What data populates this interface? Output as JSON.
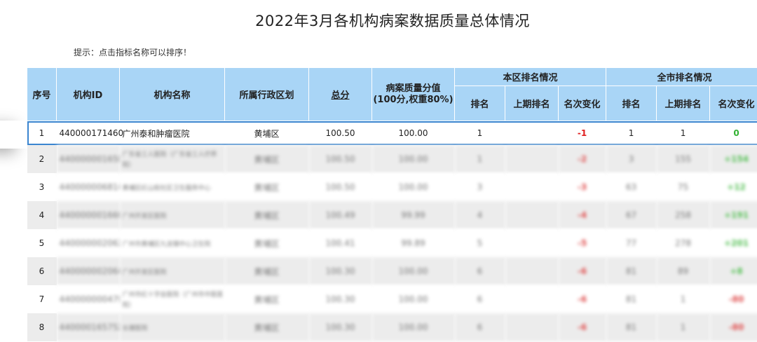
{
  "page": {
    "title": "2022年3月各机构病案数据质量总体情况",
    "hint": "提示：点击指标名称可以排序！"
  },
  "table": {
    "group_headers": {
      "district": "本区排名情况",
      "city": "全市排名情况"
    },
    "headers": {
      "index": "序号",
      "org_id": "机构ID",
      "org_name": "机构名称",
      "district": "所属行政区划",
      "total": "总分",
      "quality": "病案质量分值\n(100分,权重80%)",
      "rank": "排名",
      "prev_rank": "上期排名",
      "change": "名次变化",
      "city_rank": "排名",
      "city_prev_rank": "上期排名",
      "city_change": "名次变化"
    },
    "rows": [
      {
        "index": "1",
        "org_id": "440000171460",
        "org_name": "广州泰和肿瘤医院",
        "district": "黄埔区",
        "total": "100.50",
        "quality": "100.00",
        "rank": "1",
        "prev_rank": "",
        "change": "-1",
        "city_rank": "1",
        "city_prev_rank": "1",
        "city_change": "0",
        "change_sign": "neg",
        "city_change_sign": "pos"
      },
      {
        "index": "2",
        "org_id": "440000001650",
        "org_name": "广东省工人医院（广东省工人疗养院）",
        "district": "黄埔区",
        "total": "100.50",
        "quality": "100.00",
        "rank": "1",
        "prev_rank": "",
        "change": "-2",
        "city_rank": "3",
        "city_prev_rank": "155",
        "city_change": "+154",
        "change_sign": "neg",
        "city_change_sign": "pos"
      },
      {
        "index": "3",
        "org_id": "440000006814",
        "org_name": "黄埔区红山街社区卫生服务中心",
        "district": "黄埔区",
        "total": "100.50",
        "quality": "100.00",
        "rank": "3",
        "prev_rank": "",
        "change": "-3",
        "city_rank": "63",
        "city_prev_rank": "75",
        "city_change": "+12",
        "change_sign": "neg",
        "city_change_sign": "pos"
      },
      {
        "index": "4",
        "org_id": "440000001666",
        "org_name": "广州开发区医院",
        "district": "黄埔区",
        "total": "100.49",
        "quality": "99.99",
        "rank": "4",
        "prev_rank": "",
        "change": "-4",
        "city_rank": "67",
        "city_prev_rank": "258",
        "city_change": "+191",
        "change_sign": "neg",
        "city_change_sign": "pos"
      },
      {
        "index": "5",
        "org_id": "440000002062",
        "org_name": "广州市黄埔区九龙镇中心卫生院",
        "district": "黄埔区",
        "total": "100.41",
        "quality": "99.89",
        "rank": "5",
        "prev_rank": "",
        "change": "-5",
        "city_rank": "77",
        "city_prev_rank": "278",
        "city_change": "+201",
        "change_sign": "neg",
        "city_change_sign": "pos"
      },
      {
        "index": "6",
        "org_id": "440000002064",
        "org_name": "广州开发区医院",
        "district": "黄埔区",
        "total": "100.30",
        "quality": "100.00",
        "rank": "6",
        "prev_rank": "",
        "change": "-6",
        "city_rank": "81",
        "city_prev_rank": "89",
        "city_change": "+8",
        "change_sign": "neg",
        "city_change_sign": "pos"
      },
      {
        "index": "7",
        "org_id": "440000000479",
        "org_name": "广州市红十字会医院（广州市中医医院）",
        "district": "黄埔区",
        "total": "100.30",
        "quality": "100.00",
        "rank": "6",
        "prev_rank": "",
        "change": "-6",
        "city_rank": "81",
        "city_prev_rank": "1",
        "city_change": "-80",
        "change_sign": "neg",
        "city_change_sign": "neg"
      },
      {
        "index": "8",
        "org_id": "440000165752",
        "org_name": "长塘医院",
        "district": "黄埔区",
        "total": "100.30",
        "quality": "100.00",
        "rank": "6",
        "prev_rank": "",
        "change": "-6",
        "city_rank": "81",
        "city_prev_rank": "1",
        "city_change": "-80",
        "change_sign": "neg",
        "city_change_sign": "neg"
      }
    ]
  }
}
